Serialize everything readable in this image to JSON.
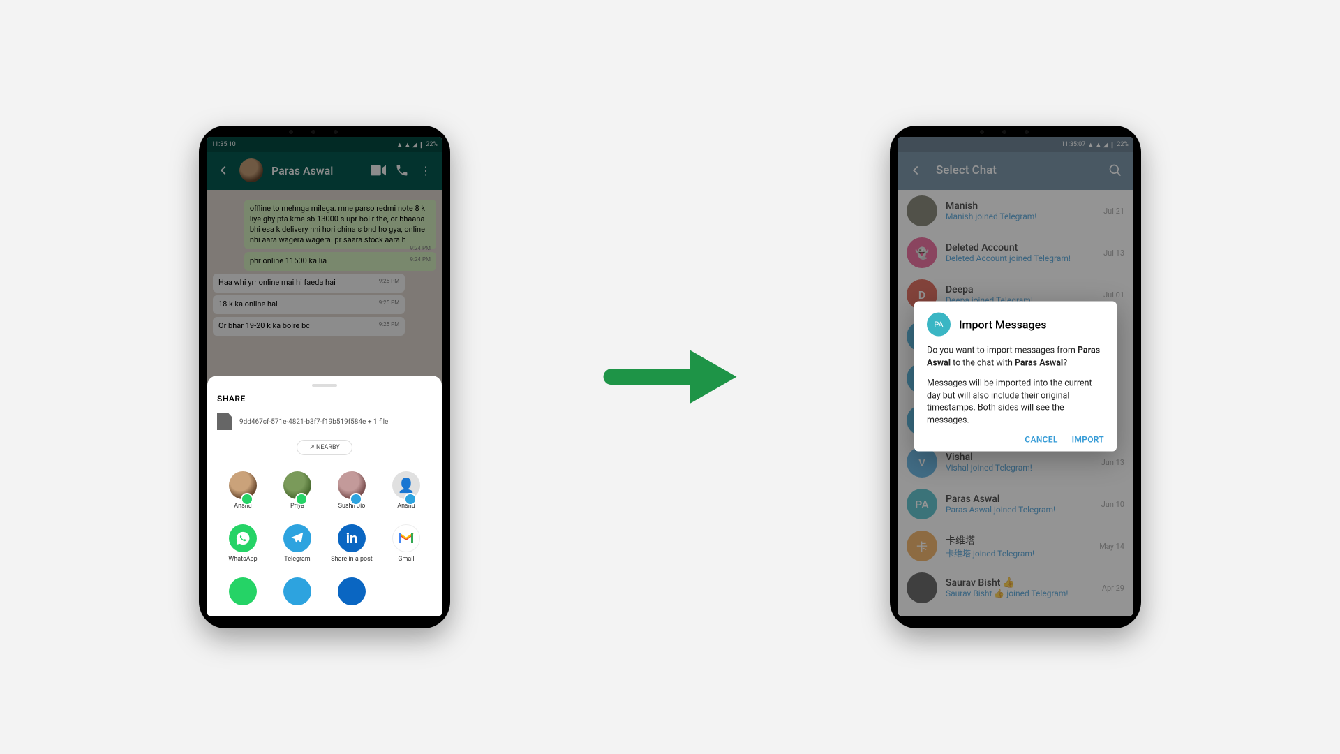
{
  "left": {
    "statusbar": {
      "time": "11:35:10",
      "battery": "22%"
    },
    "header": {
      "name": "Paras Aswal"
    },
    "messages": [
      {
        "dir": "out",
        "text": "offline to mehnga milega. mne parso redmi note 8 k liye ghy pta krne sb 13000 s upr bol r the, or bhaana bhi esa k delivery nhi hori china s bnd ho gya, online nhi aara wagera wagera. pr saara stock aara h",
        "time": "9:24 PM"
      },
      {
        "dir": "out",
        "text": "phr online 11500 ka lia",
        "time": "9:24 PM"
      },
      {
        "dir": "in",
        "text": "Haa whi yrr online mai hi faeda hai",
        "time": "9:25 PM"
      },
      {
        "dir": "in",
        "text": "18 k ka online hai",
        "time": "9:25 PM"
      },
      {
        "dir": "in",
        "text": "Or bhar 19-20 k ka bolre bc",
        "time": "9:25 PM"
      }
    ],
    "sheet": {
      "title": "SHARE",
      "file": "9dd467cf-571e-4821-b3f7-f19b519f584e + 1 file",
      "nearby": "NEARBY",
      "contacts": [
        {
          "name": "Anshu",
          "badge": "wa"
        },
        {
          "name": "Priya",
          "badge": "wa"
        },
        {
          "name": "Sushil Jio",
          "badge": "tg"
        },
        {
          "name": "Anshu",
          "badge": "tg"
        }
      ],
      "apps": [
        {
          "name": "WhatsApp",
          "bg": "#25d366",
          "icon": "wa"
        },
        {
          "name": "Telegram",
          "bg": "#2da3df",
          "icon": "tg"
        },
        {
          "name": "Share in a post",
          "bg": "#0a66c2",
          "icon": "in"
        },
        {
          "name": "Gmail",
          "bg": "#ffffff",
          "icon": "gm"
        }
      ]
    }
  },
  "right": {
    "statusbar": {
      "time": "11:35:07",
      "battery": "22%"
    },
    "header": {
      "title": "Select Chat"
    },
    "chats": [
      {
        "name": "Manish",
        "sub": "Manish joined Telegram!",
        "date": "Jul 21",
        "av_bg": "#6a6a5a",
        "initial": ""
      },
      {
        "name": "Deleted Account",
        "sub": "Deleted Account joined Telegram!",
        "date": "Jul 13",
        "av_bg": "#e84f8a",
        "initial": "👻"
      },
      {
        "name": "Deepa",
        "sub": "Deepa joined Telegram!",
        "date": "Jul 01",
        "av_bg": "#d94d3a",
        "initial": "D"
      },
      {
        "name": "",
        "sub": "",
        "date": "",
        "av_bg": "#35a7d7",
        "initial": ""
      },
      {
        "name": "",
        "sub": "",
        "date": "",
        "av_bg": "#35a7d7",
        "initial": ""
      },
      {
        "name": "",
        "sub": "",
        "date": "",
        "av_bg": "#35a7d7",
        "initial": ""
      },
      {
        "name": "Vishal",
        "sub": "Vishal joined Telegram!",
        "date": "Jun 13",
        "av_bg": "#4aa9e0",
        "initial": "V"
      },
      {
        "name": "Paras Aswal",
        "sub": "Paras Aswal joined Telegram!",
        "date": "Jun 10",
        "av_bg": "#3ab6c4",
        "initial": "PA"
      },
      {
        "name": "卡维塔",
        "sub": "卡维塔 joined Telegram!",
        "date": "May 14",
        "av_bg": "#f0a44b",
        "initial": "卡"
      },
      {
        "name": "Saurav Bisht 👍",
        "sub": "Saurav Bisht 👍 joined Telegram!",
        "date": "Apr 29",
        "av_bg": "#444",
        "initial": ""
      }
    ],
    "dialog": {
      "avatar_initials": "PA",
      "title": "Import Messages",
      "line1_pre": "Do you want to import messages from ",
      "line1_b1": "Paras Aswal",
      "line1_mid": " to the chat with ",
      "line1_b2": "Paras Aswal",
      "line1_suf": "?",
      "body2": "Messages will be imported into the current day but will also include their original timestamps. Both sides will see the messages.",
      "cancel": "CANCEL",
      "import": "IMPORT"
    }
  }
}
